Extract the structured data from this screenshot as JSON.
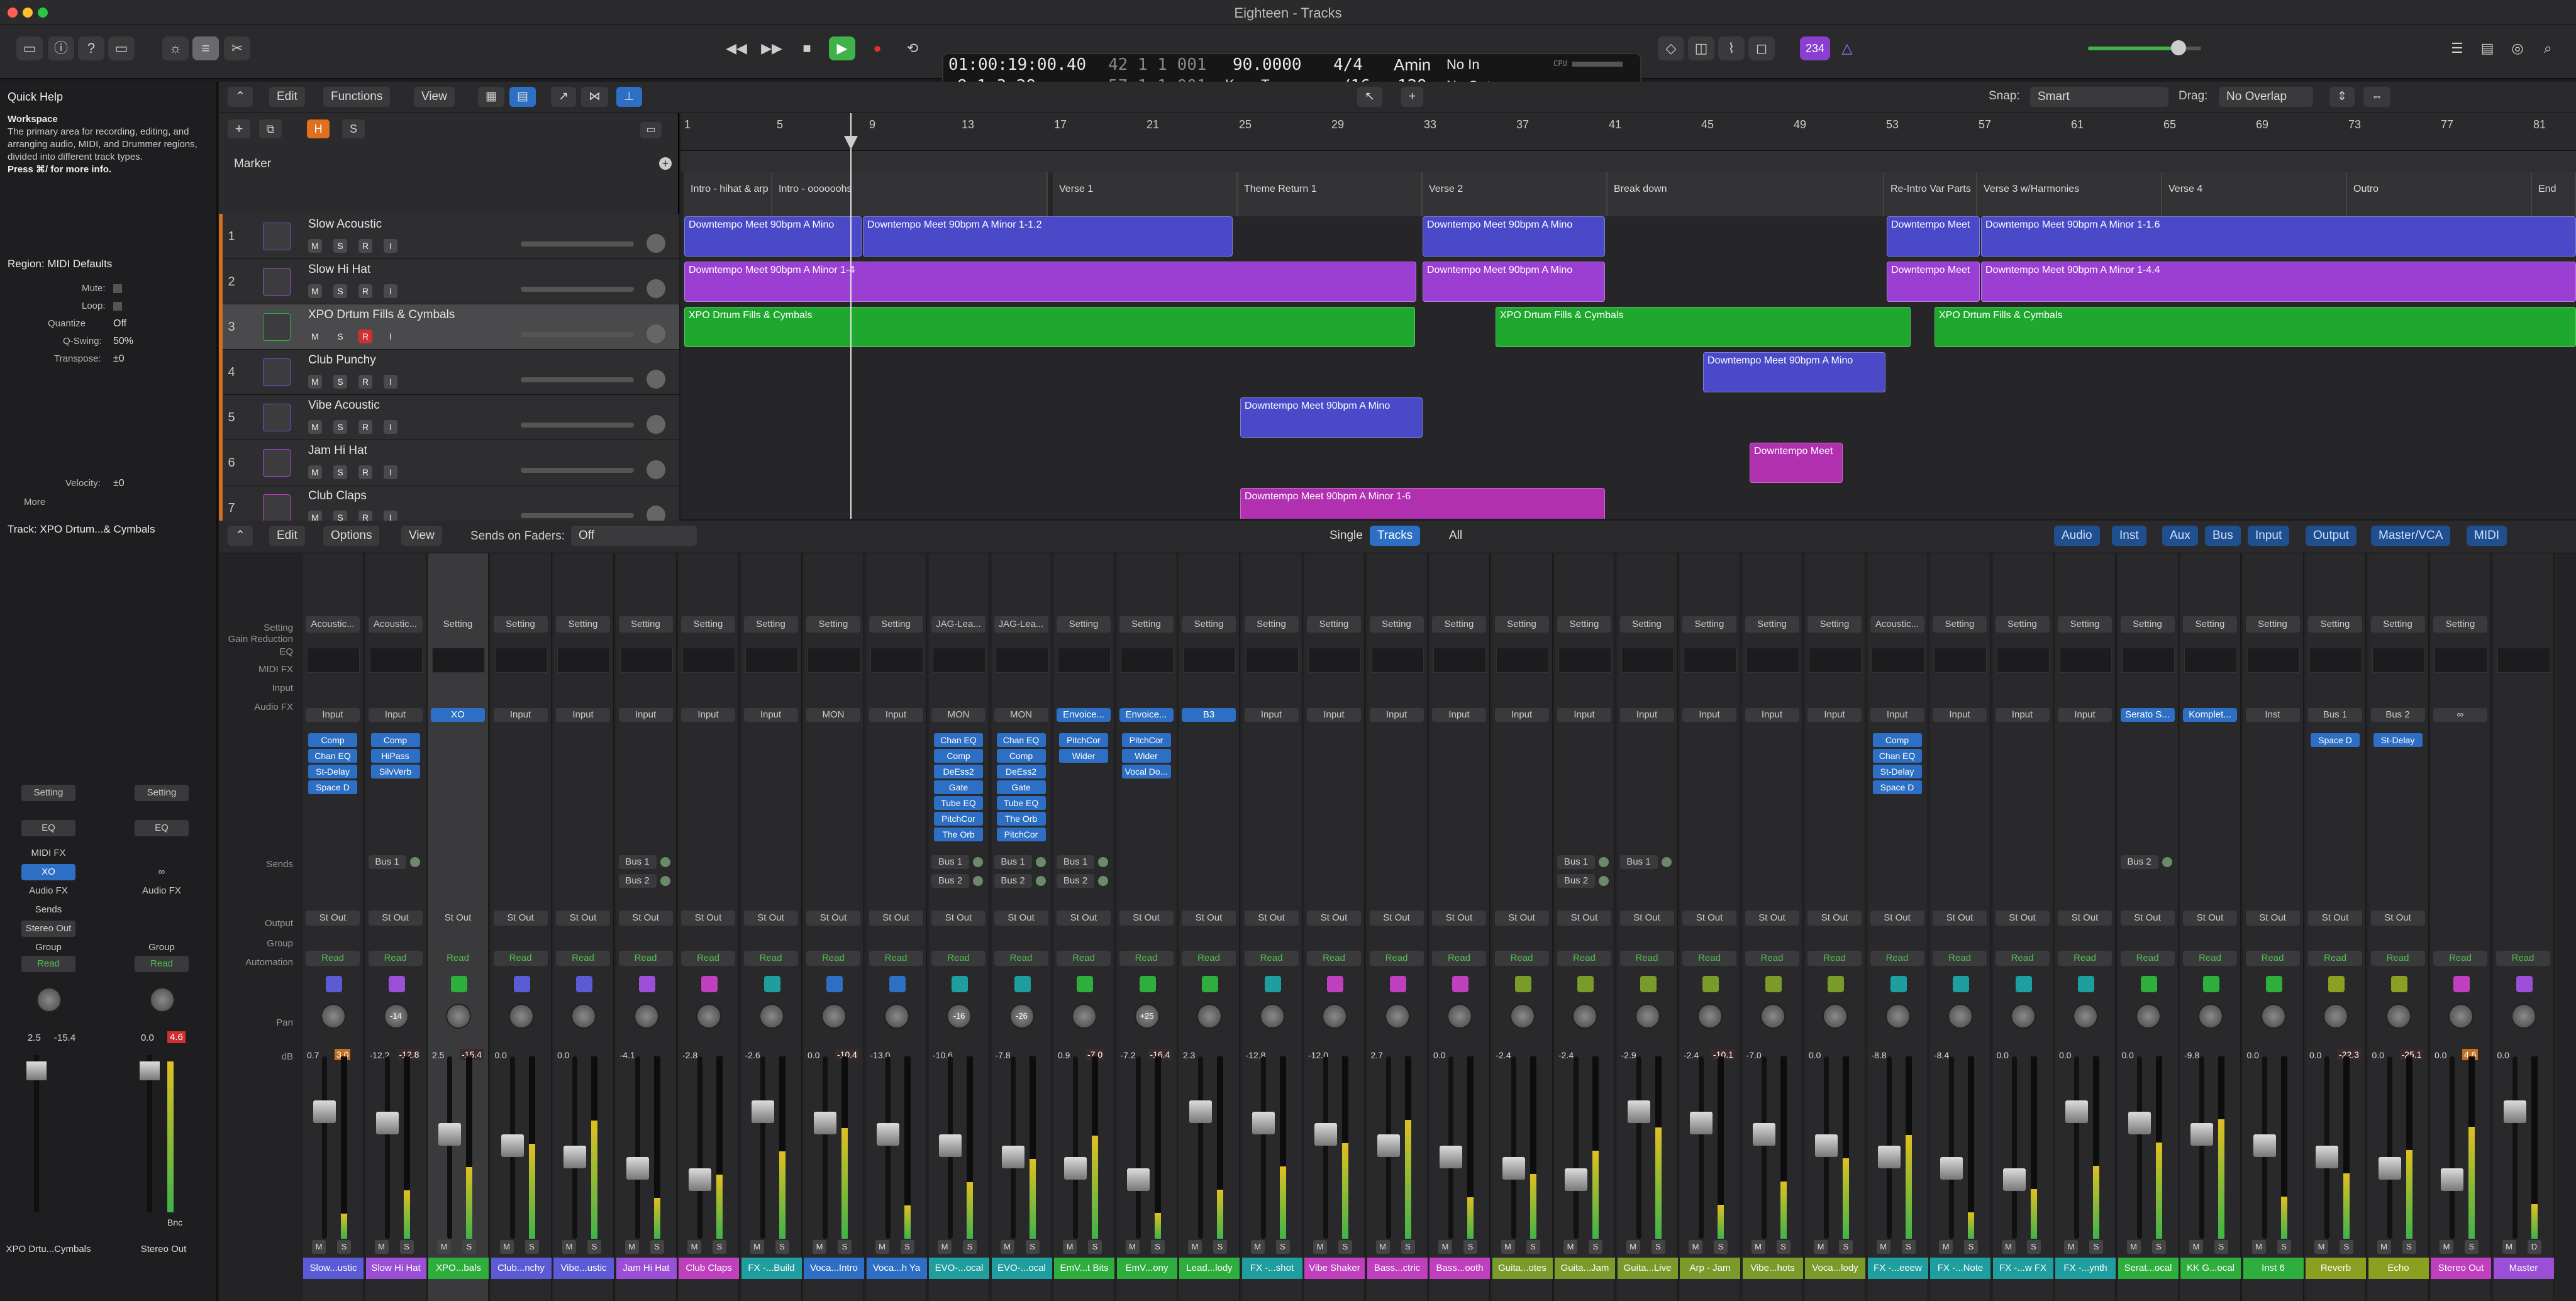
{
  "window": {
    "title": "Eighteen - Tracks"
  },
  "lcd": {
    "time": "01:00:19:00.40",
    "time_sub": "42  1  1  001",
    "bars": "8  1  3  29",
    "bars_sub": "57  1  1  001",
    "tempo": "90.0000",
    "tempo_mode": "Keep Tempo",
    "signature": "4/4",
    "division": "/16",
    "key": "Amin",
    "midi_in": "No In",
    "midi_out": "No Out",
    "cpu_label": "CPU",
    "hd_label": "HD",
    "count": "129"
  },
  "control": {
    "badge": "234",
    "colors": {
      "badge": "#8a3fd1",
      "play": "#3fb34a",
      "record": "#e03030"
    }
  },
  "inspector": {
    "quick_help_title": "Quick Help",
    "quick_help_heading": "Workspace",
    "quick_help_body": "The primary area for recording, editing, and arranging audio, MIDI, and Drummer regions, divided into different track types.",
    "quick_help_more": "Press ⌘/ for more info.",
    "region_title": "Region: MIDI Defaults",
    "mute_label": "Mute:",
    "loop_label": "Loop:",
    "quantize_label": "Quantize",
    "quantize_value": "Off",
    "qswing_label": "Q-Swing:",
    "qswing_value": "50%",
    "transpose_label": "Transpose:",
    "transpose_value": "±0",
    "velocity_label": "Velocity:",
    "velocity_value": "±0",
    "more_label": "More",
    "track_title": "Track: XPO Drtum...& Cymbals",
    "strip1": {
      "setting": "Setting",
      "eq": "EQ",
      "midi_fx": "MIDI FX",
      "input": "XO",
      "audio_fx": "Audio FX",
      "sends": "Sends",
      "output": "Stereo Out",
      "group": "Group",
      "automation": "Read",
      "vol": "2.5",
      "peak": "-15.4",
      "name": "XPO Drtu...Cymbals"
    },
    "strip2": {
      "setting": "Setting",
      "eq": "EQ",
      "input": "∞",
      "audio_fx": "Audio FX",
      "group": "Group",
      "automation": "Read",
      "vol": "0.0",
      "peak": "4.6",
      "bnc": "Bnc",
      "name": "Stereo Out"
    }
  },
  "tracks_toolbar": {
    "edit": "Edit",
    "functions": "Functions",
    "view": "View",
    "snap_label": "Snap:",
    "snap_value": "Smart",
    "drag_label": "Drag:",
    "drag_value": "No Overlap",
    "h_label": "H",
    "s_label": "S"
  },
  "ruler": {
    "bars": [
      "1",
      "5",
      "9",
      "13",
      "17",
      "21",
      "25",
      "29",
      "33",
      "37",
      "41",
      "45",
      "49",
      "53",
      "57",
      "61",
      "65",
      "69",
      "73",
      "77",
      "81"
    ],
    "marker_label": "Marker"
  },
  "markers": [
    "Intro - hihat & arp",
    "Intro - oooooohs",
    "Verse 1",
    "Theme Return 1",
    "Verse 2",
    "Break down",
    "Re-Intro Var Parts",
    "Verse 3 w/Harmonies",
    "Verse 4",
    "Outro",
    "End"
  ],
  "tracks": [
    {
      "num": "1",
      "name": "Slow Acoustic",
      "rec": false
    },
    {
      "num": "2",
      "name": "Slow Hi Hat",
      "rec": false
    },
    {
      "num": "3",
      "name": "XPO Drtum Fills & Cymbals",
      "rec": true
    },
    {
      "num": "4",
      "name": "Club Punchy",
      "rec": false
    },
    {
      "num": "5",
      "name": "Vibe Acoustic",
      "rec": false
    },
    {
      "num": "6",
      "name": "Jam Hi Hat",
      "rec": false
    },
    {
      "num": "7",
      "name": "Club Claps",
      "rec": false
    }
  ],
  "regions": {
    "r1a": "Downtempo Meet 90bpm A Mino",
    "r1b": "Downtempo Meet 90bpm A Minor 1-1.2",
    "r1c": "Downtempo Meet 90bpm A Mino",
    "r1d": "Downtempo Meet",
    "r1e": "Downtempo Meet 90bpm A Minor 1-1.6",
    "r2a": "Downtempo Meet 90bpm A Minor 1-4",
    "r2b": "Downtempo Meet 90bpm A Mino",
    "r2c": "Downtempo Meet",
    "r2d": "Downtempo Meet 90bpm A Minor 1-4.4",
    "r3a": "XPO Drtum Fills & Cymbals",
    "r3b": "XPO Drtum Fills & Cymbals",
    "r3c": "XPO Drtum Fills & Cymbals",
    "r4a": "Downtempo Meet 90bpm A Mino",
    "r5a": "Downtempo Meet 90bpm A Mino",
    "r6a": "Downtempo Meet",
    "r7a": "Downtempo Meet 90bpm A Minor 1-6"
  },
  "mixer_toolbar": {
    "edit": "Edit",
    "options": "Options",
    "view": "View",
    "sends_label": "Sends on Faders:",
    "sends_value": "Off",
    "single": "Single",
    "tracks": "Tracks",
    "all": "All",
    "filters": [
      "Audio",
      "Inst",
      "Aux",
      "Bus",
      "Input",
      "Output",
      "Master/VCA",
      "MIDI"
    ]
  },
  "mixer_row_labels": {
    "setting": "Setting",
    "gain": "Gain Reduction",
    "eq": "EQ",
    "midi_fx": "MIDI FX",
    "input": "Input",
    "audio_fx": "Audio FX",
    "sends": "Sends",
    "output": "Output",
    "group": "Group",
    "automation": "Automation",
    "pan": "Pan",
    "db": "dB"
  },
  "strips": [
    {
      "setting": "Acoustic...",
      "input": "Input",
      "fx": [
        "Comp",
        "Chan EQ",
        "St-Delay",
        "Space D"
      ],
      "sends": [],
      "output": "St Out",
      "auto": "Read",
      "pan": "",
      "db": "0.7",
      "peak": "3.0",
      "name": "Slow...ustic",
      "color": "#5b5bd6",
      "m": "M",
      "s": "S"
    },
    {
      "setting": "Acoustic...",
      "input": "Input",
      "fx": [
        "Comp",
        "HiPass",
        "SilvVerb"
      ],
      "sends": [
        "Bus 1"
      ],
      "output": "St Out",
      "auto": "Read",
      "pan": "-14",
      "db": "-12.2",
      "peak": "-12.8",
      "name": "Slow Hi Hat",
      "color": "#9a4fd6",
      "m": "M",
      "s": "S"
    },
    {
      "setting": "Setting",
      "input": "XO",
      "fx": [],
      "sends": [],
      "output": "St Out",
      "auto": "Read",
      "pan": "",
      "db": "2.5",
      "peak": "-15.4",
      "name": "XPO...bals",
      "color": "#2eae3c",
      "m": "M",
      "s": "S"
    },
    {
      "setting": "Setting",
      "input": "Input",
      "fx": [],
      "sends": [],
      "output": "St Out",
      "auto": "Read",
      "pan": "",
      "db": "0.0",
      "peak": "",
      "name": "Club...nchy",
      "color": "#5b5bd6",
      "m": "M",
      "s": "S"
    },
    {
      "setting": "Setting",
      "input": "Input",
      "fx": [],
      "sends": [],
      "output": "St Out",
      "auto": "Read",
      "pan": "",
      "db": "0.0",
      "peak": "",
      "name": "Vibe...ustic",
      "color": "#5b5bd6",
      "m": "M",
      "s": "S"
    },
    {
      "setting": "Setting",
      "input": "Input",
      "fx": [],
      "sends": [
        "Bus 1",
        "Bus 2"
      ],
      "output": "St Out",
      "auto": "Read",
      "pan": "",
      "db": "-4.1",
      "peak": "",
      "name": "Jam Hi Hat",
      "color": "#9a4fd6",
      "m": "M",
      "s": "S"
    },
    {
      "setting": "Setting",
      "input": "Input",
      "fx": [],
      "sends": [],
      "output": "St Out",
      "auto": "Read",
      "pan": "",
      "db": "-2.8",
      "peak": "",
      "name": "Club Claps",
      "color": "#c03fbf",
      "m": "M",
      "s": "S"
    },
    {
      "setting": "Setting",
      "input": "Input",
      "fx": [],
      "sends": [],
      "output": "St Out",
      "auto": "Read",
      "pan": "",
      "db": "-2.6",
      "peak": "",
      "name": "FX -...Build",
      "color": "#1e9e9e",
      "m": "M",
      "s": "S"
    },
    {
      "setting": "Setting",
      "input": "MON",
      "fx": [],
      "sends": [],
      "output": "St Out",
      "auto": "Read",
      "pan": "",
      "db": "0.0",
      "peak": "-10.4",
      "name": "Voca...Intro",
      "color": "#2d6fc4",
      "m": "M",
      "s": "S"
    },
    {
      "setting": "Setting",
      "input": "Input",
      "fx": [],
      "sends": [],
      "output": "St Out",
      "auto": "Read",
      "pan": "",
      "db": "-13.0",
      "peak": "",
      "name": "Voca...h Ya",
      "color": "#2d6fc4",
      "m": "M",
      "s": "S"
    },
    {
      "setting": "JAG-Lea...",
      "input": "MON",
      "fx": [
        "Chan EQ",
        "Comp",
        "DeEss2",
        "Gate",
        "Tube EQ",
        "PitchCor",
        "The Orb"
      ],
      "sends": [
        "Bus 1",
        "Bus 2"
      ],
      "output": "St Out",
      "auto": "Read",
      "pan": "-16",
      "db": "-10.6",
      "peak": "",
      "name": "EVO-...ocal",
      "color": "#1e9e9e",
      "m": "M",
      "s": "S"
    },
    {
      "setting": "JAG-Lea...",
      "input": "MON",
      "fx": [
        "Chan EQ",
        "Comp",
        "DeEss2",
        "Gate",
        "Tube EQ",
        "The Orb",
        "PitchCor"
      ],
      "sends": [
        "Bus 1",
        "Bus 2"
      ],
      "output": "St Out",
      "auto": "Read",
      "pan": "-26",
      "db": "-7.8",
      "peak": "",
      "name": "EVO-...ocal",
      "color": "#1e9e9e",
      "m": "M",
      "s": "S"
    },
    {
      "setting": "Setting",
      "input": "Envoice...",
      "fx": [
        "PitchCor",
        "Wider"
      ],
      "sends": [
        "Bus 1",
        "Bus 2"
      ],
      "output": "St Out",
      "auto": "Read",
      "pan": "",
      "db": "0.9",
      "peak": "-7.0",
      "name": "EmV...t Bits",
      "color": "#2eae3c",
      "m": "M",
      "s": "S"
    },
    {
      "setting": "Setting",
      "input": "Envoice...",
      "fx": [
        "PitchCor",
        "Wider",
        "Vocal Do..."
      ],
      "sends": [],
      "output": "St Out",
      "auto": "Read",
      "pan": "+25",
      "db": "-7.2",
      "peak": "-16.4",
      "name": "EmV...ony",
      "color": "#2eae3c",
      "m": "M",
      "s": "S"
    },
    {
      "setting": "Setting",
      "input": "B3",
      "fx": [],
      "sends": [],
      "output": "St Out",
      "auto": "Read",
      "pan": "",
      "db": "2.3",
      "peak": "",
      "name": "Lead...lody",
      "color": "#2eae3c",
      "m": "M",
      "s": "S"
    },
    {
      "setting": "Setting",
      "input": "Input",
      "fx": [],
      "sends": [],
      "output": "St Out",
      "auto": "Read",
      "pan": "",
      "db": "-12.8",
      "peak": "",
      "name": "FX -...shot",
      "color": "#1e9e9e",
      "m": "M",
      "s": "S"
    },
    {
      "setting": "Setting",
      "input": "Input",
      "fx": [],
      "sends": [],
      "output": "St Out",
      "auto": "Read",
      "pan": "",
      "db": "-12.0",
      "peak": "",
      "name": "Vibe Shaker",
      "color": "#c03fbf",
      "m": "M",
      "s": "S"
    },
    {
      "setting": "Setting",
      "input": "Input",
      "fx": [],
      "sends": [],
      "output": "St Out",
      "auto": "Read",
      "pan": "",
      "db": "2.7",
      "peak": "",
      "name": "Bass...ctric",
      "color": "#c03fbf",
      "m": "M",
      "s": "S"
    },
    {
      "setting": "Setting",
      "input": "Input",
      "fx": [],
      "sends": [],
      "output": "St Out",
      "auto": "Read",
      "pan": "",
      "db": "0.0",
      "peak": "",
      "name": "Bass...ooth",
      "color": "#c03fbf",
      "m": "M",
      "s": "S"
    },
    {
      "setting": "Setting",
      "input": "Input",
      "fx": [],
      "sends": [],
      "output": "St Out",
      "auto": "Read",
      "pan": "",
      "db": "-2.4",
      "peak": "",
      "name": "Guita...otes",
      "color": "#7a9a2a",
      "m": "M",
      "s": "S"
    },
    {
      "setting": "Setting",
      "input": "Input",
      "fx": [],
      "sends": [
        "Bus 1",
        "Bus 2"
      ],
      "output": "St Out",
      "auto": "Read",
      "pan": "",
      "db": "-2.4",
      "peak": "",
      "name": "Guita...Jam",
      "color": "#7a9a2a",
      "m": "M",
      "s": "S"
    },
    {
      "setting": "Setting",
      "input": "Input",
      "fx": [],
      "sends": [
        "Bus 1"
      ],
      "output": "St Out",
      "auto": "Read",
      "pan": "",
      "db": "-2.9",
      "peak": "",
      "name": "Guita...Live",
      "color": "#7a9a2a",
      "m": "M",
      "s": "S"
    },
    {
      "setting": "Setting",
      "input": "Input",
      "fx": [],
      "sends": [],
      "output": "St Out",
      "auto": "Read",
      "pan": "",
      "db": "-2.4",
      "peak": "-10.1",
      "name": "Arp - Jam",
      "color": "#7a9a2a",
      "m": "M",
      "s": "S"
    },
    {
      "setting": "Setting",
      "input": "Input",
      "fx": [],
      "sends": [],
      "output": "St Out",
      "auto": "Read",
      "pan": "",
      "db": "-7.0",
      "peak": "",
      "name": "Vibe...hots",
      "color": "#7a9a2a",
      "m": "M",
      "s": "S"
    },
    {
      "setting": "Setting",
      "input": "Input",
      "fx": [],
      "sends": [],
      "output": "St Out",
      "auto": "Read",
      "pan": "",
      "db": "0.0",
      "peak": "",
      "name": "Voca...lody",
      "color": "#7a9a2a",
      "m": "M",
      "s": "S"
    },
    {
      "setting": "Acoustic...",
      "input": "Input",
      "fx": [
        "Comp",
        "Chan EQ",
        "St-Delay",
        "Space D"
      ],
      "sends": [],
      "output": "St Out",
      "auto": "Read",
      "pan": "",
      "db": "-8.8",
      "peak": "",
      "name": "FX -...eeew",
      "color": "#1e9e9e",
      "m": "M",
      "s": "S"
    },
    {
      "setting": "Setting",
      "input": "Input",
      "fx": [],
      "sends": [],
      "output": "St Out",
      "auto": "Read",
      "pan": "",
      "db": "-8.4",
      "peak": "",
      "name": "FX -...Note",
      "color": "#1e9e9e",
      "m": "M",
      "s": "S"
    },
    {
      "setting": "Setting",
      "input": "Input",
      "fx": [],
      "sends": [],
      "output": "St Out",
      "auto": "Read",
      "pan": "",
      "db": "0.0",
      "peak": "",
      "name": "FX -...w FX",
      "color": "#1e9e9e",
      "m": "M",
      "s": "S"
    },
    {
      "setting": "Setting",
      "input": "Input",
      "fx": [],
      "sends": [],
      "output": "St Out",
      "auto": "Read",
      "pan": "",
      "db": "0.0",
      "peak": "",
      "name": "FX -...ynth",
      "color": "#1e9e9e",
      "m": "M",
      "s": "S"
    },
    {
      "setting": "Setting",
      "input": "Serato S...",
      "fx": [],
      "sends": [
        "Bus 2"
      ],
      "output": "St Out",
      "auto": "Read",
      "pan": "",
      "db": "0.0",
      "peak": "",
      "name": "Serat...ocal",
      "color": "#2eae3c",
      "m": "M",
      "s": "S"
    },
    {
      "setting": "Setting",
      "input": "Komplet...",
      "fx": [],
      "sends": [],
      "output": "St Out",
      "auto": "Read",
      "pan": "",
      "db": "-9.8",
      "peak": "",
      "name": "KK G...ocal",
      "color": "#2eae3c",
      "m": "M",
      "s": "S"
    },
    {
      "setting": "Setting",
      "input": "Inst",
      "fx": [],
      "sends": [],
      "output": "St Out",
      "auto": "Read",
      "pan": "",
      "db": "0.0",
      "peak": "",
      "name": "Inst 6",
      "color": "#2eae3c",
      "m": "M",
      "s": "S"
    },
    {
      "setting": "Setting",
      "input": "Bus 1",
      "fx": [
        "Space D"
      ],
      "sends": [],
      "output": "St Out",
      "auto": "Read",
      "pan": "",
      "db": "0.0",
      "peak": "-22.3",
      "name": "Reverb",
      "color": "#8aa020",
      "m": "M",
      "s": "S"
    },
    {
      "setting": "Setting",
      "input": "Bus 2",
      "fx": [
        "St-Delay"
      ],
      "sends": [],
      "output": "St Out",
      "auto": "Read",
      "pan": "",
      "db": "0.0",
      "peak": "-25.1",
      "name": "Echo",
      "color": "#8aa020",
      "m": "M",
      "s": "S"
    },
    {
      "setting": "Setting",
      "input": "∞",
      "fx": [],
      "sends": [],
      "output": "",
      "auto": "Read",
      "pan": "",
      "db": "0.0",
      "peak": "4.6",
      "name": "Stereo Out",
      "color": "#c03fbf",
      "m": "M",
      "s": "S"
    },
    {
      "setting": "",
      "input": "",
      "fx": [],
      "sends": [],
      "output": "",
      "auto": "Read",
      "pan": "",
      "db": "0.0",
      "peak": "",
      "name": "Master",
      "color": "#9a4fd6",
      "m": "M",
      "s": "D"
    }
  ]
}
